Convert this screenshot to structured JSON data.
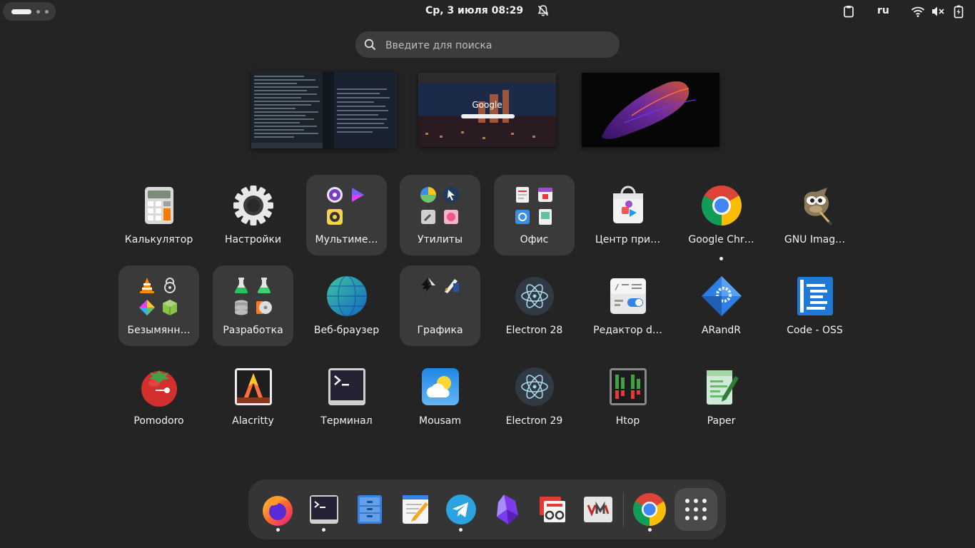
{
  "topbar": {
    "clock": "Ср, 3 июля  08:29",
    "lang": "ru"
  },
  "search": {
    "placeholder": "Введите для поиска"
  },
  "workspaces": {
    "google_label": "Google"
  },
  "apps": [
    {
      "label": "Калькулятор",
      "icon": "calculator-icon"
    },
    {
      "label": "Настройки",
      "icon": "settings-gear-icon"
    },
    {
      "label": "Мультиме…",
      "icon": "folder-icon"
    },
    {
      "label": "Утилиты",
      "icon": "folder-icon"
    },
    {
      "label": "Офис",
      "icon": "folder-icon"
    },
    {
      "label": "Центр при…",
      "icon": "software-center-icon"
    },
    {
      "label": "Google Chr…",
      "icon": "chrome-icon"
    },
    {
      "label": "GNU Imag…",
      "icon": "gimp-icon"
    },
    {
      "label": "Безымянн…",
      "icon": "folder-icon"
    },
    {
      "label": "Разработка",
      "icon": "folder-icon"
    },
    {
      "label": "Веб-браузер",
      "icon": "globe-icon"
    },
    {
      "label": "Графика",
      "icon": "folder-icon"
    },
    {
      "label": "Electron 28",
      "icon": "electron-icon"
    },
    {
      "label": "Редактор d…",
      "icon": "dconf-editor-icon"
    },
    {
      "label": "ARandR",
      "icon": "arandr-icon"
    },
    {
      "label": "Code - OSS",
      "icon": "code-oss-icon"
    },
    {
      "label": "Pomodoro",
      "icon": "tomato-icon"
    },
    {
      "label": "Alacritty",
      "icon": "alacritty-icon"
    },
    {
      "label": "Терминал",
      "icon": "terminal-icon"
    },
    {
      "label": "Mousam",
      "icon": "weather-icon"
    },
    {
      "label": "Electron 29",
      "icon": "electron-icon"
    },
    {
      "label": "Htop",
      "icon": "htop-icon"
    },
    {
      "label": "Paper",
      "icon": "paper-icon"
    }
  ],
  "dock": [
    {
      "icon": "firefox-icon"
    },
    {
      "icon": "terminal-icon"
    },
    {
      "icon": "files-icon"
    },
    {
      "icon": "text-editor-icon"
    },
    {
      "icon": "telegram-icon"
    },
    {
      "icon": "obsidian-icon"
    },
    {
      "icon": "presentation-icon"
    },
    {
      "icon": "virtual-machine-icon"
    },
    {
      "icon": "chrome-icon"
    },
    {
      "icon": "show-apps-icon"
    }
  ]
}
